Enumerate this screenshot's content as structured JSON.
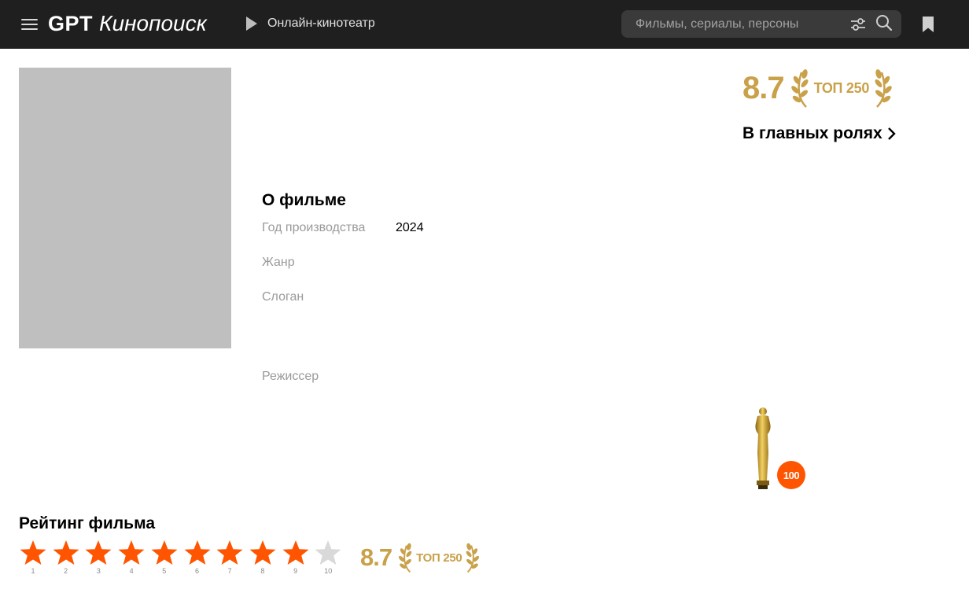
{
  "header": {
    "logo_gpt": "GPT",
    "logo_name": "Кинопоиск",
    "cinema_label": "Онлайн-кинотеатр",
    "search_placeholder": "Фильмы, сериалы, персоны"
  },
  "movie": {
    "rating": "8.7",
    "top_label": "ТОП 250",
    "cast_label": "В главных ролях",
    "about_title": "О фильме",
    "fields": [
      {
        "label": "Год производства",
        "value": "2024"
      },
      {
        "label": "Жанр",
        "value": ""
      },
      {
        "label": "Слоган",
        "value": ""
      },
      {
        "label": "Режиссер",
        "value": ""
      }
    ],
    "oscar_badge": "100"
  },
  "user_rating": {
    "title": "Рейтинг фильма",
    "selected": 9,
    "max": 10,
    "star_numbers": [
      "1",
      "2",
      "3",
      "4",
      "5",
      "6",
      "7",
      "8",
      "9",
      "10"
    ],
    "rating": "8.7",
    "top_label": "ТОП 250"
  },
  "colors": {
    "header_bg": "#1f1f1f",
    "gold": "#c9a14a",
    "star_active": "#ff5500",
    "star_inactive": "#d9d9d9"
  }
}
